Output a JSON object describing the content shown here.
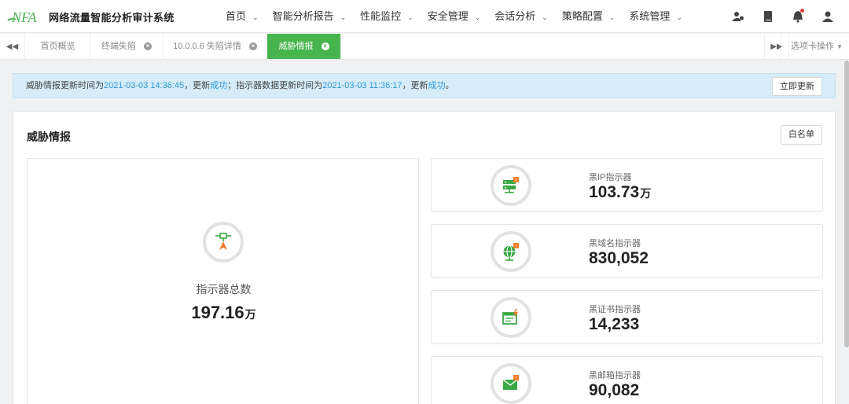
{
  "app": {
    "logo_text": "NFA",
    "title": "网络流量智能分析审计系统"
  },
  "nav": [
    {
      "label": "首页"
    },
    {
      "label": "智能分析报告"
    },
    {
      "label": "性能监控"
    },
    {
      "label": "安全管理"
    },
    {
      "label": "会话分析"
    },
    {
      "label": "策略配置"
    },
    {
      "label": "系统管理"
    }
  ],
  "top_icons": [
    "user-cloud-icon",
    "book-icon",
    "bell-icon",
    "user-icon"
  ],
  "tabs": [
    {
      "label": "首页概览",
      "closable": false,
      "active": false
    },
    {
      "label": "终端失陷",
      "closable": true,
      "active": false
    },
    {
      "label": "10.0.0.6 失陷详情",
      "closable": true,
      "active": false
    },
    {
      "label": "威胁情报",
      "closable": true,
      "active": true
    }
  ],
  "tab_ops_label": "选项卡操作",
  "banner": {
    "p1": "威胁情报更新时间为",
    "time1": "2021-03-03 14:36:45",
    "p2": "，更新",
    "status1": "成功",
    "p3": "；指示器数据更新时间为",
    "time2": "2021-03-03 11:36:17",
    "p4": "，更新",
    "status2": "成功",
    "p5": "。",
    "button": "立即更新"
  },
  "panel": {
    "title": "威胁情报",
    "whitelist_button": "白名单",
    "total": {
      "label": "指示器总数",
      "value": "197.16",
      "unit": "万"
    },
    "stats": [
      {
        "label": "黑IP指示器",
        "value": "103.73",
        "unit": "万",
        "icon": "server-icon"
      },
      {
        "label": "黑域名指示器",
        "value": "830,052",
        "unit": "",
        "icon": "globe-icon"
      },
      {
        "label": "黑证书指示器",
        "value": "14,233",
        "unit": "",
        "icon": "certificate-icon"
      },
      {
        "label": "黑邮箱指示器",
        "value": "90,082",
        "unit": "",
        "icon": "mail-icon"
      }
    ]
  },
  "colors": {
    "accent": "#47b54d",
    "link": "#2e9ad6",
    "icon_green": "#3aa845",
    "icon_orange": "#f07b2a",
    "banner_bg": "#d6ecf8"
  }
}
